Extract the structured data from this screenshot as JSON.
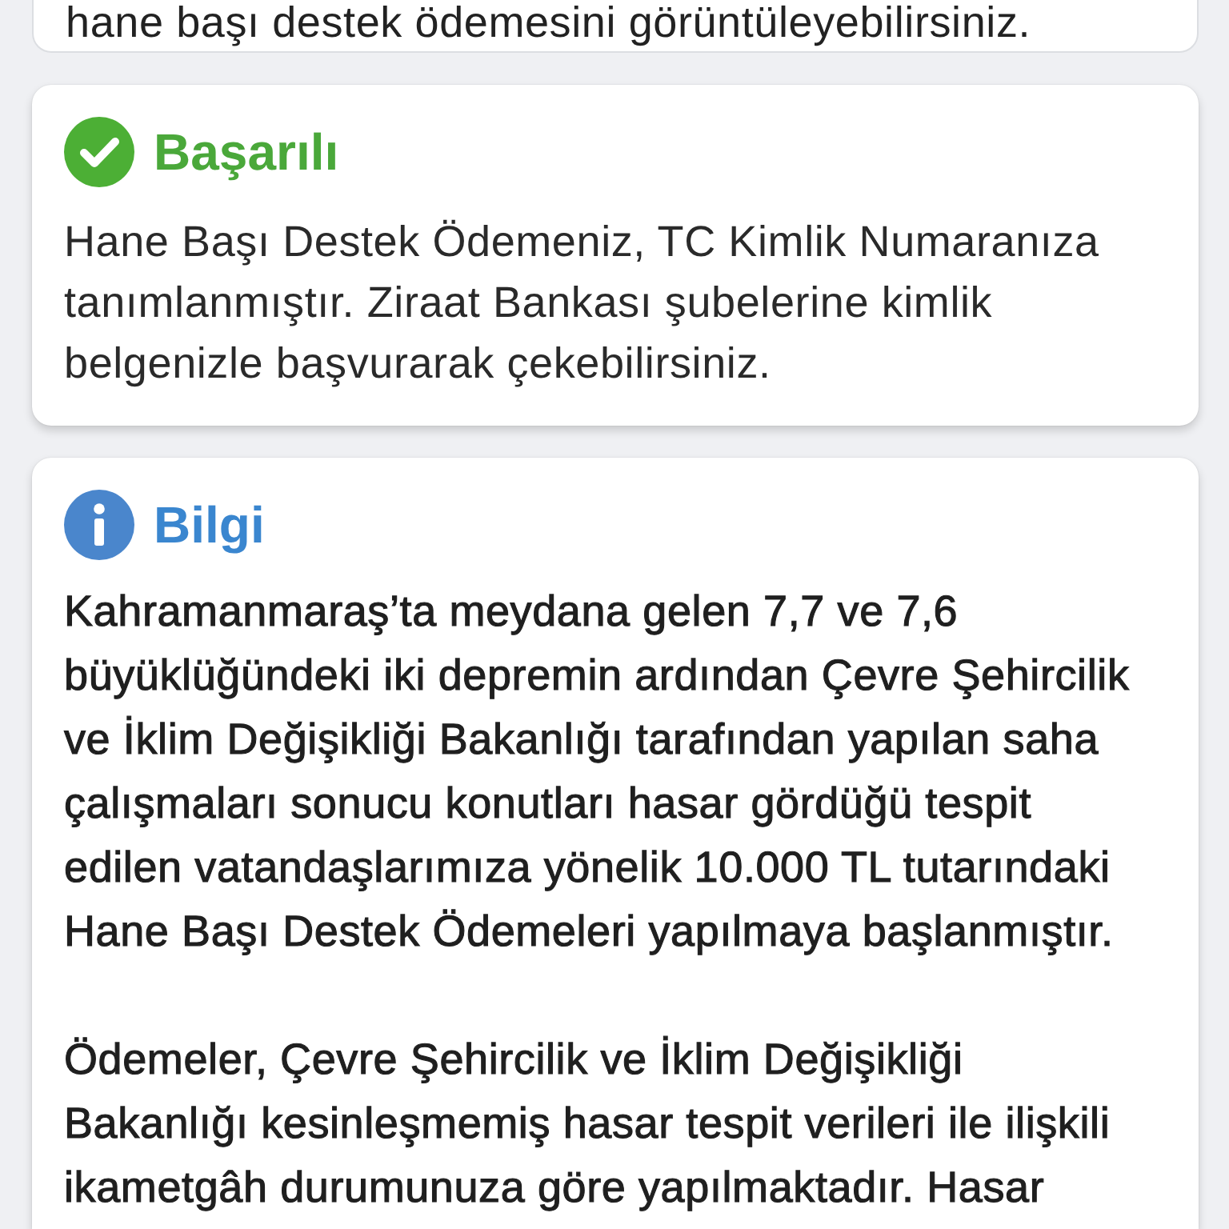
{
  "cards": [
    {
      "kind": "plain",
      "paragraphs": [
        "hane başı destek ödemesini görüntüleyebilirsiniz."
      ]
    },
    {
      "kind": "success",
      "title": "Başarılı",
      "paragraphs": [
        "Hane Başı Destek Ödemeniz, TC Kimlik Numaranıza tanımlanmıştır. Ziraat Bankası şubelerine kimlik belgenizle başvurarak çekebilirsiniz."
      ]
    },
    {
      "kind": "info",
      "title": "Bilgi",
      "paragraphs": [
        "Kahramanmaraş’ta meydana gelen 7,7 ve 7,6 büyüklüğündeki iki depremin ardından Çevre Şehircilik ve İklim Değişikliği Bakanlığı tarafından yapılan saha çalışmaları sonucu konutları hasar gördüğü tespit edilen vatandaşlarımıza yönelik 10.000 TL tutarındaki Hane Başı Destek Ödemeleri yapılmaya başlanmıştır.",
        "Ödemeler, Çevre Şehircilik ve İklim Değişikliği Bakanlığı kesinleşmemiş hasar tespit verileri ile ilişkili ikametgâh durumunuza göre yapılmaktadır. Hasar"
      ]
    }
  ]
}
